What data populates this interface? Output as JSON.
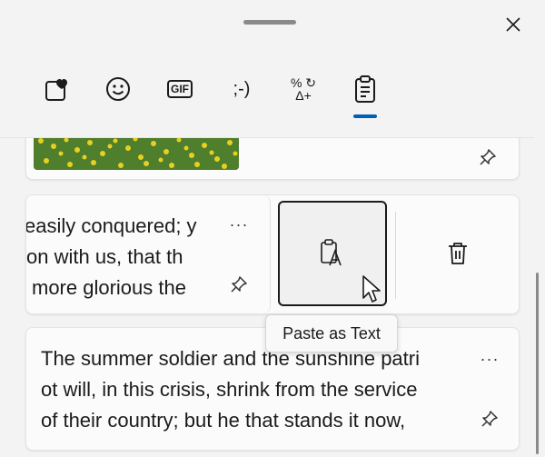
{
  "tabs": [
    {
      "label": "Favorites",
      "icon": "heart-box-icon",
      "selected": false
    },
    {
      "label": "Emoji",
      "icon": "smiley-icon",
      "selected": false
    },
    {
      "label": "GIF",
      "icon": "gif-icon",
      "text": "GIF",
      "selected": false
    },
    {
      "label": "Kaomoji",
      "icon": "kaomoji-icon",
      "text": ";-)",
      "selected": false
    },
    {
      "label": "Symbols",
      "icon": "symbols-icon",
      "text_top": "%",
      "text_top2": "↻",
      "text_bottom": "Δ+",
      "selected": false
    },
    {
      "label": "Clipboard",
      "icon": "clipboard-icon",
      "selected": true
    }
  ],
  "clipboard": {
    "items": [
      {
        "type": "image",
        "description": "flower meadow"
      },
      {
        "type": "text",
        "lines": [
          "easily conquered; y",
          "on with us, that th",
          "more glorious the"
        ]
      },
      {
        "type": "text",
        "lines": [
          "The summer soldier and the sunshine patri",
          "ot will, in this crisis, shrink from the service",
          "of their country; but he that stands it now,"
        ]
      }
    ],
    "more_glyph": "···",
    "swipe_actions": {
      "paste_as_text_label": "Paste as Text",
      "delete_label": "Delete"
    }
  },
  "tooltip": {
    "text": "Paste as Text"
  },
  "colors": {
    "accent": "#005fb8",
    "panel": "#f3f3f3",
    "card": "#fbfbfb"
  }
}
